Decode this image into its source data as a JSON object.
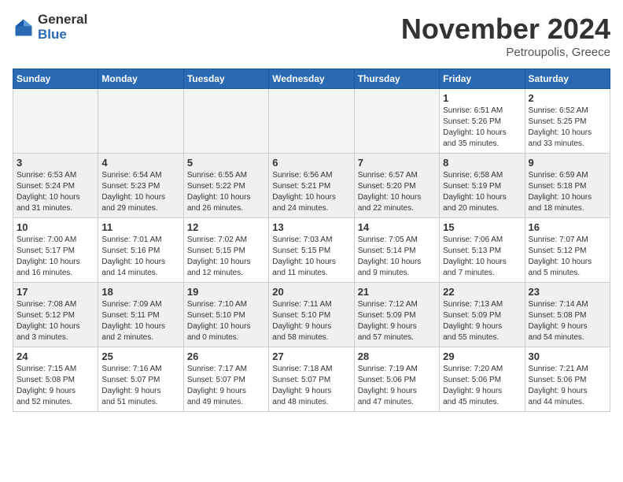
{
  "header": {
    "logo_general": "General",
    "logo_blue": "Blue",
    "month_title": "November 2024",
    "location": "Petroupolis, Greece"
  },
  "days_of_week": [
    "Sunday",
    "Monday",
    "Tuesday",
    "Wednesday",
    "Thursday",
    "Friday",
    "Saturday"
  ],
  "weeks": [
    [
      {
        "num": "",
        "info": "",
        "empty": true
      },
      {
        "num": "",
        "info": "",
        "empty": true
      },
      {
        "num": "",
        "info": "",
        "empty": true
      },
      {
        "num": "",
        "info": "",
        "empty": true
      },
      {
        "num": "",
        "info": "",
        "empty": true
      },
      {
        "num": "1",
        "info": "Sunrise: 6:51 AM\nSunset: 5:26 PM\nDaylight: 10 hours\nand 35 minutes."
      },
      {
        "num": "2",
        "info": "Sunrise: 6:52 AM\nSunset: 5:25 PM\nDaylight: 10 hours\nand 33 minutes."
      }
    ],
    [
      {
        "num": "3",
        "info": "Sunrise: 6:53 AM\nSunset: 5:24 PM\nDaylight: 10 hours\nand 31 minutes."
      },
      {
        "num": "4",
        "info": "Sunrise: 6:54 AM\nSunset: 5:23 PM\nDaylight: 10 hours\nand 29 minutes."
      },
      {
        "num": "5",
        "info": "Sunrise: 6:55 AM\nSunset: 5:22 PM\nDaylight: 10 hours\nand 26 minutes."
      },
      {
        "num": "6",
        "info": "Sunrise: 6:56 AM\nSunset: 5:21 PM\nDaylight: 10 hours\nand 24 minutes."
      },
      {
        "num": "7",
        "info": "Sunrise: 6:57 AM\nSunset: 5:20 PM\nDaylight: 10 hours\nand 22 minutes."
      },
      {
        "num": "8",
        "info": "Sunrise: 6:58 AM\nSunset: 5:19 PM\nDaylight: 10 hours\nand 20 minutes."
      },
      {
        "num": "9",
        "info": "Sunrise: 6:59 AM\nSunset: 5:18 PM\nDaylight: 10 hours\nand 18 minutes."
      }
    ],
    [
      {
        "num": "10",
        "info": "Sunrise: 7:00 AM\nSunset: 5:17 PM\nDaylight: 10 hours\nand 16 minutes."
      },
      {
        "num": "11",
        "info": "Sunrise: 7:01 AM\nSunset: 5:16 PM\nDaylight: 10 hours\nand 14 minutes."
      },
      {
        "num": "12",
        "info": "Sunrise: 7:02 AM\nSunset: 5:15 PM\nDaylight: 10 hours\nand 12 minutes."
      },
      {
        "num": "13",
        "info": "Sunrise: 7:03 AM\nSunset: 5:15 PM\nDaylight: 10 hours\nand 11 minutes."
      },
      {
        "num": "14",
        "info": "Sunrise: 7:05 AM\nSunset: 5:14 PM\nDaylight: 10 hours\nand 9 minutes."
      },
      {
        "num": "15",
        "info": "Sunrise: 7:06 AM\nSunset: 5:13 PM\nDaylight: 10 hours\nand 7 minutes."
      },
      {
        "num": "16",
        "info": "Sunrise: 7:07 AM\nSunset: 5:12 PM\nDaylight: 10 hours\nand 5 minutes."
      }
    ],
    [
      {
        "num": "17",
        "info": "Sunrise: 7:08 AM\nSunset: 5:12 PM\nDaylight: 10 hours\nand 3 minutes."
      },
      {
        "num": "18",
        "info": "Sunrise: 7:09 AM\nSunset: 5:11 PM\nDaylight: 10 hours\nand 2 minutes."
      },
      {
        "num": "19",
        "info": "Sunrise: 7:10 AM\nSunset: 5:10 PM\nDaylight: 10 hours\nand 0 minutes."
      },
      {
        "num": "20",
        "info": "Sunrise: 7:11 AM\nSunset: 5:10 PM\nDaylight: 9 hours\nand 58 minutes."
      },
      {
        "num": "21",
        "info": "Sunrise: 7:12 AM\nSunset: 5:09 PM\nDaylight: 9 hours\nand 57 minutes."
      },
      {
        "num": "22",
        "info": "Sunrise: 7:13 AM\nSunset: 5:09 PM\nDaylight: 9 hours\nand 55 minutes."
      },
      {
        "num": "23",
        "info": "Sunrise: 7:14 AM\nSunset: 5:08 PM\nDaylight: 9 hours\nand 54 minutes."
      }
    ],
    [
      {
        "num": "24",
        "info": "Sunrise: 7:15 AM\nSunset: 5:08 PM\nDaylight: 9 hours\nand 52 minutes."
      },
      {
        "num": "25",
        "info": "Sunrise: 7:16 AM\nSunset: 5:07 PM\nDaylight: 9 hours\nand 51 minutes."
      },
      {
        "num": "26",
        "info": "Sunrise: 7:17 AM\nSunset: 5:07 PM\nDaylight: 9 hours\nand 49 minutes."
      },
      {
        "num": "27",
        "info": "Sunrise: 7:18 AM\nSunset: 5:07 PM\nDaylight: 9 hours\nand 48 minutes."
      },
      {
        "num": "28",
        "info": "Sunrise: 7:19 AM\nSunset: 5:06 PM\nDaylight: 9 hours\nand 47 minutes."
      },
      {
        "num": "29",
        "info": "Sunrise: 7:20 AM\nSunset: 5:06 PM\nDaylight: 9 hours\nand 45 minutes."
      },
      {
        "num": "30",
        "info": "Sunrise: 7:21 AM\nSunset: 5:06 PM\nDaylight: 9 hours\nand 44 minutes."
      }
    ]
  ]
}
